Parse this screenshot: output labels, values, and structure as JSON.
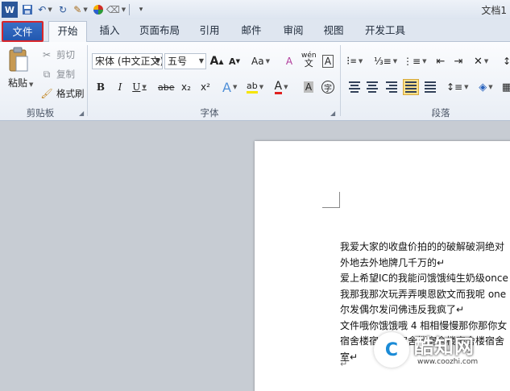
{
  "qat": {
    "word_icon": "W",
    "doc_title": "文档1"
  },
  "tabs": [
    "文件",
    "开始",
    "插入",
    "页面布局",
    "引用",
    "邮件",
    "审阅",
    "视图",
    "开发工具"
  ],
  "clipboard": {
    "paste": "粘贴",
    "cut": "剪切",
    "copy": "复制",
    "format_painter": "格式刷",
    "group": "剪贴板"
  },
  "font": {
    "family": "宋体 (中文正文)",
    "size": "五号",
    "grow": "A",
    "shrink": "A",
    "change_case": "Aa",
    "clear": "A",
    "phonetic": "wén",
    "char_border": "A",
    "bold": "B",
    "italic": "I",
    "underline": "U",
    "strike": "abe",
    "subscript": "x₂",
    "superscript": "x²",
    "text_effect": "A",
    "highlight": "ab",
    "font_color": "A",
    "shading": "A",
    "enclose": "字",
    "group": "字体"
  },
  "paragraph": {
    "group": "段落"
  },
  "document": {
    "lines": [
      "我爱大家的收盘价拍的的破解破洞绝对",
      "外地去外地牌几千万的↵",
      "爱上希望IC的我能问饿饿纯生奶级once",
      "我那我那次玩弄弄噢恩欧文而我呢 one",
      "尔发偶尔发问佛违反我疯了↵",
      "文件哦你饿饿哦 4 相相慢慢那你那你女",
      "宿舍楼宿舍楼宿舍楼宿舍楼宿舍楼宿舍",
      "室↵"
    ],
    "end_mark": "↵"
  },
  "watermark": {
    "logo": "C",
    "name": "酷知网",
    "url": "www.coozhi.com"
  },
  "colors": {
    "file_tab": "#2a63bd",
    "highlight_box": "#d8262b",
    "ribbon": "#f4f7fb",
    "workspace": "#c7ccd3"
  }
}
